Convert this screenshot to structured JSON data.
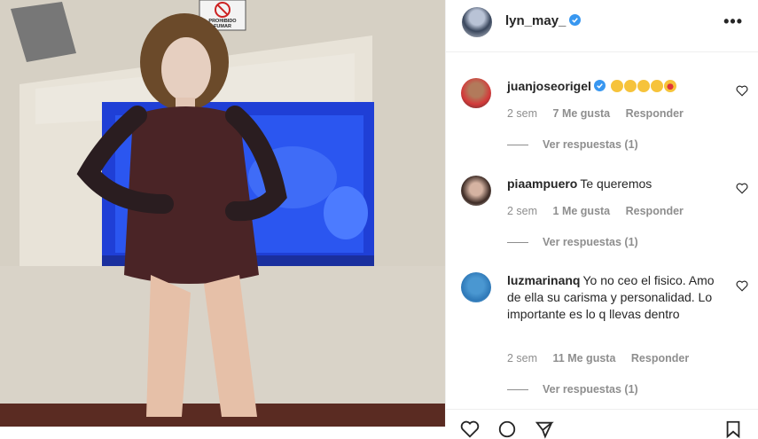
{
  "post": {
    "username": "lyn_may_",
    "verified": true,
    "photo_sign": "PROHIBIDO FUMAR"
  },
  "comments": [
    {
      "username": "juanjoseorigel",
      "verified": true,
      "text": "",
      "emoji": [
        "clap-emoji",
        "clap-emoji",
        "clap-emoji",
        "clap-emoji",
        "heart-eyes-emoji"
      ],
      "time": "2 sem",
      "likes": "7 Me gusta",
      "reply": "Responder",
      "replies": "Ver respuestas (1)"
    },
    {
      "username": "piaampuero",
      "verified": false,
      "text": "Te queremos",
      "time": "2 sem",
      "likes": "1 Me gusta",
      "reply": "Responder",
      "replies": "Ver respuestas (1)"
    },
    {
      "username": "luzmarinanq",
      "verified": false,
      "text": "Yo no ceo el fisico. Amo de ella su carisma y personalidad. Lo importante es lo q llevas dentro",
      "time": "2 sem",
      "likes": "11 Me gusta",
      "reply": "Responder",
      "replies": "Ver respuestas (1)"
    }
  ],
  "colors": {
    "verified_blue": "#3897f0",
    "meta_gray": "#8e8e8e",
    "text": "#262626"
  }
}
